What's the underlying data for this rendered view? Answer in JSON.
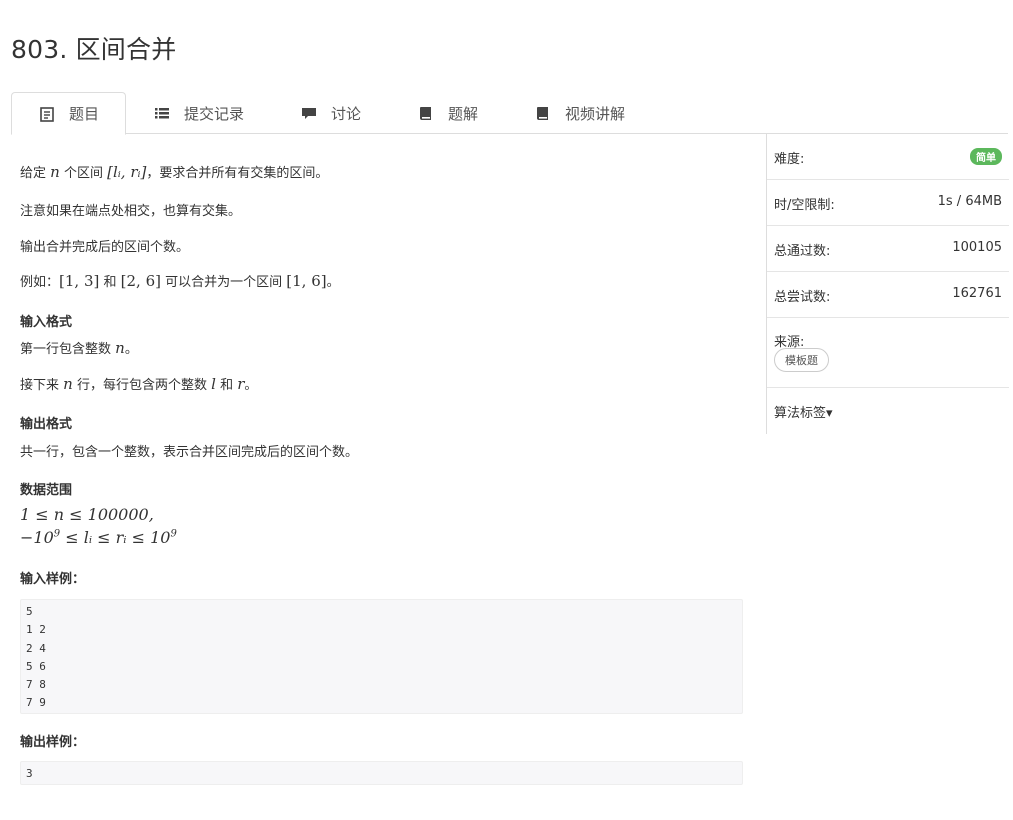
{
  "problem": {
    "title": "803. 区间合并"
  },
  "tabs": [
    {
      "label": "题目",
      "icon": "document-icon"
    },
    {
      "label": "提交记录",
      "icon": "list-icon"
    },
    {
      "label": "讨论",
      "icon": "comment-icon"
    },
    {
      "label": "题解",
      "icon": "book-icon"
    },
    {
      "label": "视频讲解",
      "icon": "book-icon"
    }
  ],
  "content": {
    "line1_a": "给定",
    "line1_n": "n",
    "line1_b": "个区间",
    "line1_interval": "[lᵢ, rᵢ]",
    "line1_c": "，要求合并所有有交集的区间。",
    "line2": "注意如果在端点处相交，也算有交集。",
    "line3": "输出合并完成后的区间个数。",
    "line4_a": "例如：",
    "line4_i1": "[1, 3]",
    "line4_b": "和",
    "line4_i2": "[2, 6]",
    "line4_c": "可以合并为一个区间",
    "line4_i3": "[1, 6]",
    "line4_d": "。",
    "input_format_title": "输入格式",
    "input_line1_a": "第一行包含整数",
    "input_line1_n": "n",
    "input_line1_b": "。",
    "input_line2_a": "接下来",
    "input_line2_n": "n",
    "input_line2_b": "行，每行包含两个整数",
    "input_line2_l": "l",
    "input_line2_c": "和",
    "input_line2_r": "r",
    "input_line2_d": "。",
    "output_format_title": "输出格式",
    "output_line": "共一行，包含一个整数，表示合并区间完成后的区间个数。",
    "range_title": "数据范围",
    "range1": "1 ≤ n ≤ 100000,",
    "range2_pre": "−10",
    "range2_sup1": "9",
    "range2_mid": " ≤ lᵢ ≤ rᵢ ≤ 10",
    "range2_sup2": "9",
    "sample_input_title": "输入样例：",
    "sample_input": [
      "5",
      "1 2",
      "2 4",
      "5 6",
      "7 8",
      "7 9"
    ],
    "sample_output_title": "输出样例：",
    "sample_output": [
      "3"
    ]
  },
  "sidebar": {
    "difficulty_label": "难度:",
    "difficulty_value": "简单",
    "limit_label": "时/空限制:",
    "limit_value": "1s / 64MB",
    "passed_label": "总通过数:",
    "passed_value": "100105",
    "tried_label": "总尝试数:",
    "tried_value": "162761",
    "source_label": "来源:",
    "source_tag": "模板题",
    "algo_tags_label": "算法标签▾"
  },
  "colors": {
    "accent_green": "#5cb85c",
    "code_bg": "#f7f7f9",
    "border": "#dddddd"
  }
}
